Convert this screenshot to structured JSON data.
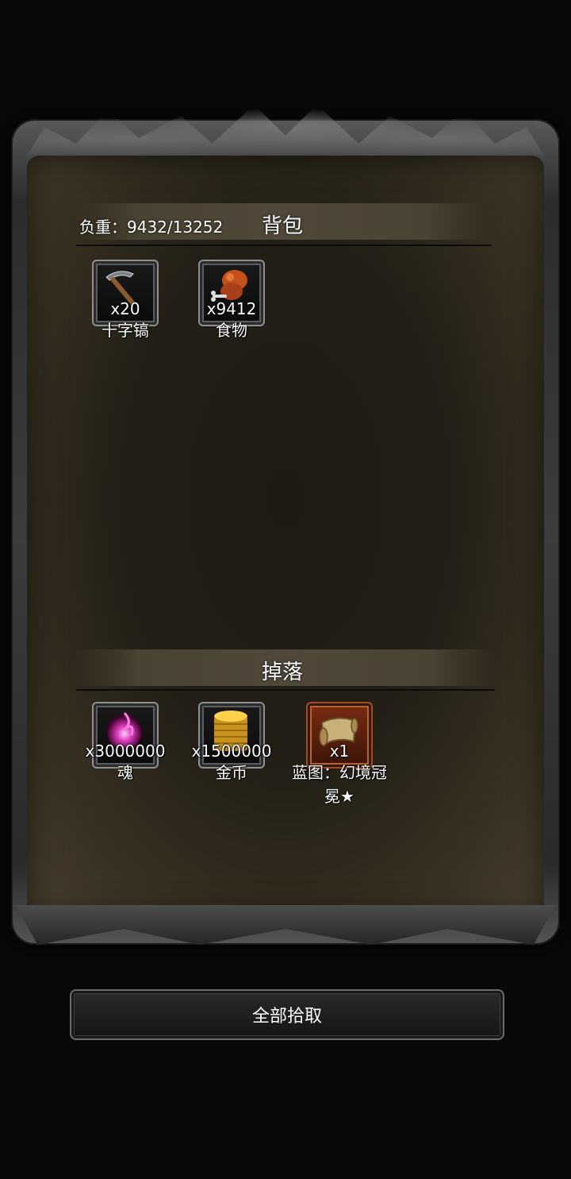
{
  "backpack": {
    "weight_label": "负重：9432/13252",
    "title": "背包",
    "items": [
      {
        "qty": "x20",
        "name": "十字镐",
        "icon": "pickaxe-icon"
      },
      {
        "qty": "x9412",
        "name": "食物",
        "icon": "meat-icon"
      }
    ]
  },
  "drops": {
    "title": "掉落",
    "items": [
      {
        "qty": "x3000000",
        "name": "魂",
        "icon": "soul-orb-icon"
      },
      {
        "qty": "x1500000",
        "name": "金币",
        "icon": "gold-coins-icon"
      },
      {
        "qty": "x1",
        "name": "蓝图：幻境冠冕★",
        "icon": "blueprint-scroll-icon"
      }
    ]
  },
  "pickup_all_label": "全部拾取",
  "colors": {
    "background": "#080808",
    "parchment": "#231f16",
    "banner": "#51483a"
  }
}
